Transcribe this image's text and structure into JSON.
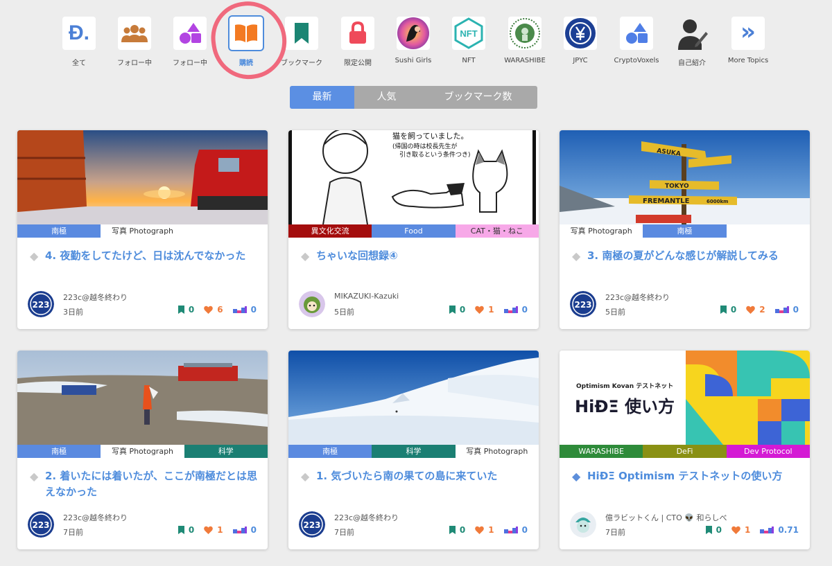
{
  "topics": [
    {
      "label": "全て"
    },
    {
      "label": "フォロー中"
    },
    {
      "label": "フォロー中"
    },
    {
      "label": "購読"
    },
    {
      "label": "ブックマーク"
    },
    {
      "label": "限定公開"
    },
    {
      "label": "Sushi Girls"
    },
    {
      "label": "NFT"
    },
    {
      "label": "WARASHIBE"
    },
    {
      "label": "JPYC"
    },
    {
      "label": "CryptoVoxels"
    },
    {
      "label": "自己紹介"
    },
    {
      "label": "More Topics"
    }
  ],
  "icon_glyphs": {
    "all": "Đ.",
    "nft": "NFT",
    "more": "»"
  },
  "sort_tabs": [
    "最新",
    "人気",
    "ブックマーク数"
  ],
  "thumb_text": {
    "manga_line1": "猫を飼っていました。",
    "manga_line2": "(帰国の時は校長先生が",
    "manga_line3": "引き取るという条件つき)",
    "sign1": "ASUKA",
    "sign2": "TOKYO",
    "sign3": "FREMANTLE",
    "sign3_dist": "6000km",
    "hide_sub": "Optimism Kovan テストネット",
    "hide_title": "HiÐΞ 使い方"
  },
  "cards": [
    {
      "tags": [
        "南極",
        "写真 Photograph"
      ],
      "title": "4. 夜勤をしてたけど、日は沈んでなかった",
      "author": "223c@越冬終わり",
      "date": "3日前",
      "bookmarks": "0",
      "likes": "6",
      "tokens": "0"
    },
    {
      "tags": [
        "異文化交流",
        "Food",
        "CAT・猫・ねこ"
      ],
      "title": "ちゃいな回想録④",
      "author": "MIKAZUKI-Kazuki",
      "date": "5日前",
      "bookmarks": "0",
      "likes": "1",
      "tokens": "0"
    },
    {
      "tags": [
        "写真 Photograph",
        "南極"
      ],
      "title": "3. 南極の夏がどんな感じが解説してみる",
      "author": "223c@越冬終わり",
      "date": "5日前",
      "bookmarks": "0",
      "likes": "2",
      "tokens": "0"
    },
    {
      "tags": [
        "南極",
        "写真 Photograph",
        "科学"
      ],
      "title": "2. 着いたには着いたが、ここが南極だとは思えなかった",
      "author": "223c@越冬終わり",
      "date": "7日前",
      "bookmarks": "0",
      "likes": "1",
      "tokens": "0"
    },
    {
      "tags": [
        "南極",
        "科学",
        "写真 Photograph"
      ],
      "title": "1. 気づいたら南の果ての島に来ていた",
      "author": "223c@越冬終わり",
      "date": "7日前",
      "bookmarks": "0",
      "likes": "1",
      "tokens": "0"
    },
    {
      "tags": [
        "WARASHIBE",
        "DeFi",
        "Dev Protocol"
      ],
      "title": "HiÐΞ Optimism テストネットの使い方",
      "author": "億ラビットくん | CTO 👽 和らしべ",
      "date": "7日前",
      "bookmarks": "0",
      "likes": "1",
      "tokens": "0.71"
    }
  ],
  "avatar_text": "223",
  "colors": {
    "accent": "#5b8fe3",
    "tag_blue": "#5a8ae0",
    "tag_white": "#ffffff",
    "tag_teal": "#1b7f73",
    "tag_darkred": "#a40d0d",
    "tag_pink": "#f7a8e8",
    "tag_green": "#2e8b3a",
    "tag_olive": "#8a9114",
    "tag_magenta": "#d41ad4",
    "highlight_circle": "#f0697d"
  }
}
